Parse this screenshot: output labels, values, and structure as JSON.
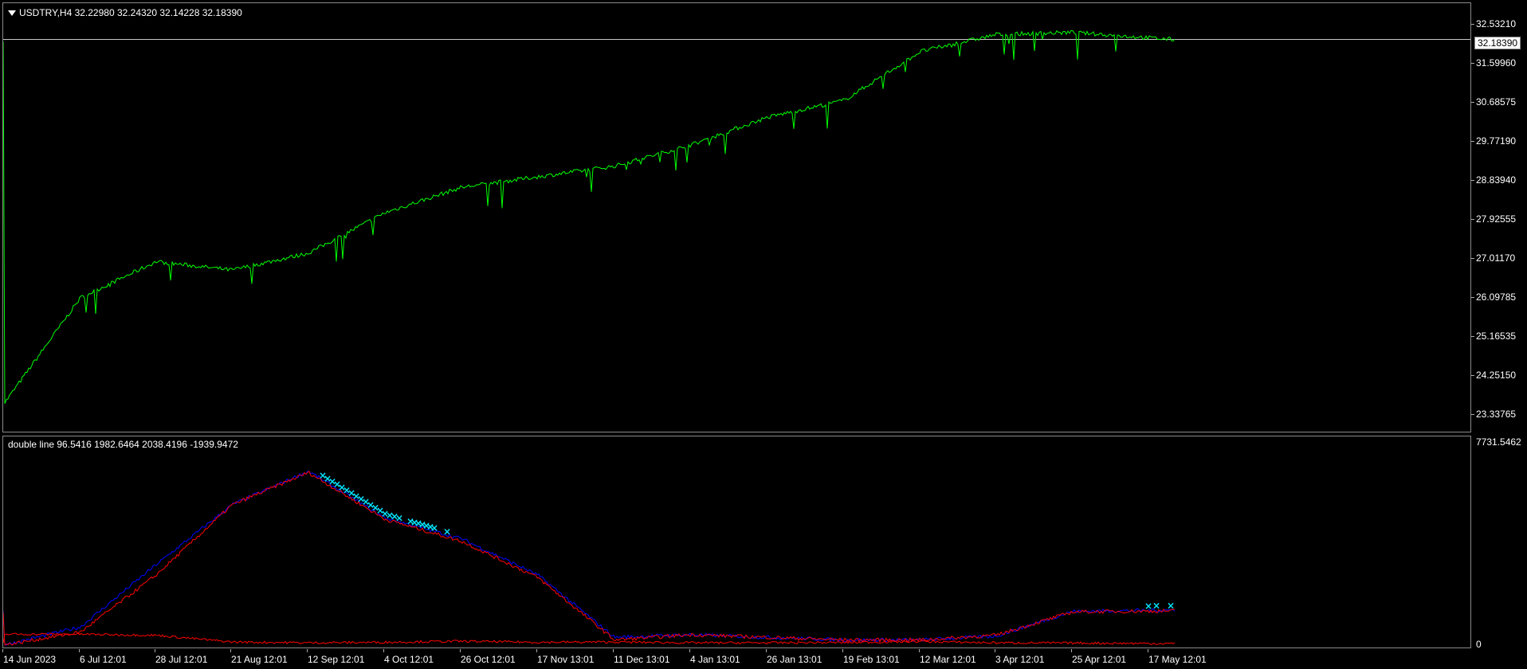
{
  "main_chart": {
    "header": "USDTRY,H4  32.22980 32.24320 32.14228 32.18390",
    "current_price": "32.18390",
    "price_axis": [
      "32.53210",
      "31.59960",
      "30.68575",
      "29.77190",
      "28.83940",
      "27.92555",
      "27.01170",
      "26.09785",
      "25.16535",
      "24.25150",
      "23.33765"
    ],
    "line_color": "#00ff00"
  },
  "indicator": {
    "header": "double line 96.5416 1982.6464 2038.4196 -1939.9472",
    "axis_top": "7731.5462",
    "axis_bottom": "0",
    "colors": {
      "blue": "#0000ff",
      "red": "#ff0000",
      "marker": "#00e5ff"
    }
  },
  "time_axis": [
    "14 Jun 2023",
    "6 Jul 12:01",
    "28 Jul 12:01",
    "21 Aug 12:01",
    "12 Sep 12:01",
    "4 Oct 12:01",
    "26 Oct 12:01",
    "17 Nov 13:01",
    "11 Dec 13:01",
    "4 Jan 13:01",
    "26 Jan 13:01",
    "19 Feb 13:01",
    "12 Mar 12:01",
    "3 Apr 12:01",
    "25 Apr 12:01",
    "17 May 12:01"
  ],
  "chart_data": [
    {
      "type": "line",
      "series": [
        {
          "name": "USDTRY,H4",
          "x": [
            "14 Jun 2023",
            "6 Jul 12:01",
            "28 Jul 12:01",
            "21 Aug 12:01",
            "12 Sep 12:01",
            "4 Oct 12:01",
            "26 Oct 12:01",
            "17 Nov 13:01",
            "11 Dec 13:01",
            "4 Jan 13:01",
            "26 Jan 13:01",
            "19 Feb 13:01",
            "12 Mar 12:01",
            "3 Apr 12:01",
            "25 Apr 12:01",
            "17 May 12:01"
          ],
          "values": [
            23.6,
            26.1,
            26.95,
            26.75,
            27.15,
            28.1,
            28.7,
            28.95,
            29.2,
            29.7,
            30.35,
            30.75,
            31.9,
            32.3,
            32.35,
            32.18
          ]
        }
      ],
      "ylim": [
        23.33765,
        32.5321
      ]
    },
    {
      "type": "line",
      "series": [
        {
          "name": "blue",
          "values": [
            0,
            700,
            3100,
            5400,
            6700,
            4900,
            4100,
            2700,
            300,
            400,
            300,
            200,
            200,
            350,
            1300,
            1350
          ]
        },
        {
          "name": "red",
          "values": [
            0,
            500,
            2700,
            5400,
            6650,
            4850,
            4000,
            2600,
            200,
            400,
            300,
            200,
            200,
            380,
            1280,
            1320
          ]
        },
        {
          "name": "red",
          "values": [
            420,
            420,
            380,
            120,
            90,
            110,
            150,
            110,
            120,
            90,
            90,
            100,
            140,
            90,
            80,
            60
          ]
        }
      ],
      "ylim": [
        0,
        7731.5462
      ]
    }
  ]
}
